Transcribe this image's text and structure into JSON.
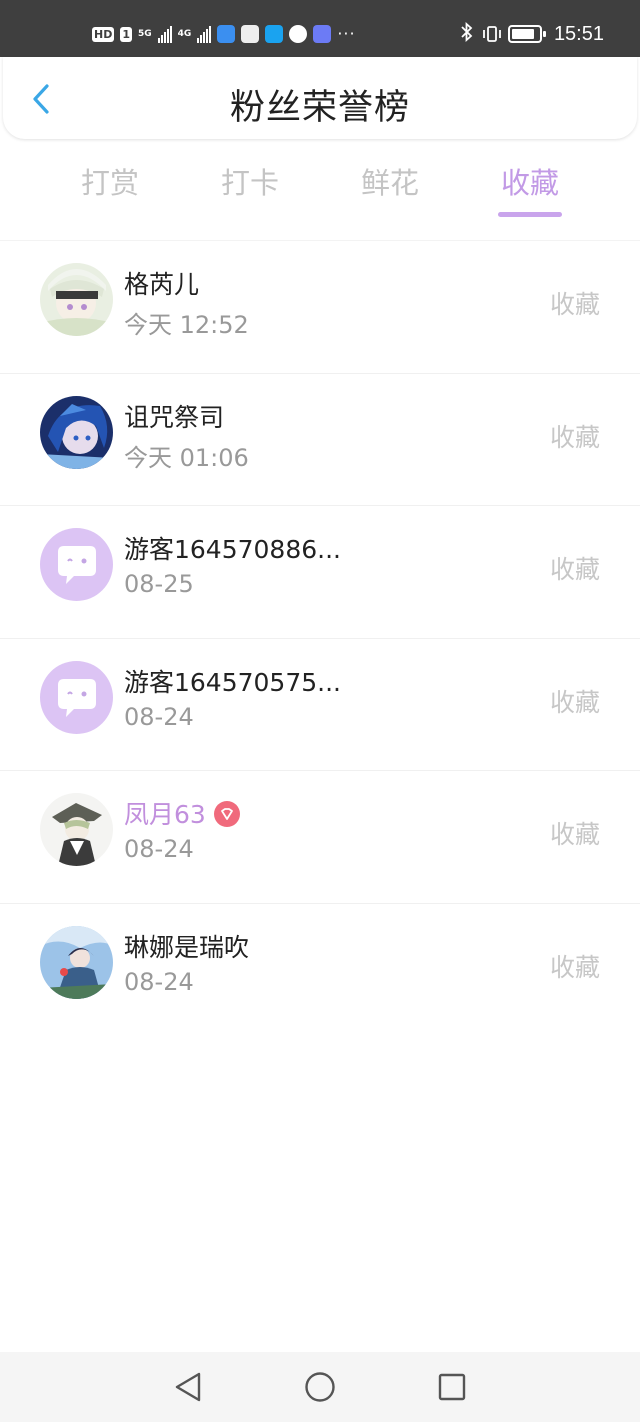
{
  "status_bar": {
    "left_tags": [
      "HD",
      "1"
    ],
    "network_1": "5G",
    "network_2": "4G",
    "app_icons": [
      "cloud-icon",
      "huawei-icon",
      "search-app-icon",
      "browser-icon",
      "music-icon"
    ],
    "more": "···",
    "time": "15:51",
    "battery_level": 0.85
  },
  "header": {
    "title": "粉丝荣誉榜"
  },
  "tabs": [
    {
      "label": "打赏",
      "active": false
    },
    {
      "label": "打卡",
      "active": false
    },
    {
      "label": "鲜花",
      "active": false
    },
    {
      "label": "收藏",
      "active": true
    }
  ],
  "fans": [
    {
      "name": "格芮儿",
      "time": "今天 12:52",
      "action": "收藏",
      "avatar": "anime-girl-white-hair"
    },
    {
      "name": "诅咒祭司",
      "time": "今天 01:06",
      "action": "收藏",
      "avatar": "anime-boy-blue-hair"
    },
    {
      "name": "游客164570886...",
      "time": "08-25",
      "action": "收藏",
      "avatar": "default-chat-bubble"
    },
    {
      "name": "游客164570575...",
      "time": "08-24",
      "action": "收藏",
      "avatar": "default-chat-bubble"
    },
    {
      "name": "凤月63",
      "time": "08-24",
      "action": "收藏",
      "avatar": "anime-character-hat",
      "vip": true
    },
    {
      "name": "琳娜是瑞吹",
      "time": "08-24",
      "action": "收藏",
      "avatar": "anime-character-sky"
    }
  ],
  "colors": {
    "accent": "#c29ae6",
    "vip_name": "#c18fdd",
    "back_arrow": "#3aa7e6",
    "inactive_tab": "#c4c4c4"
  }
}
